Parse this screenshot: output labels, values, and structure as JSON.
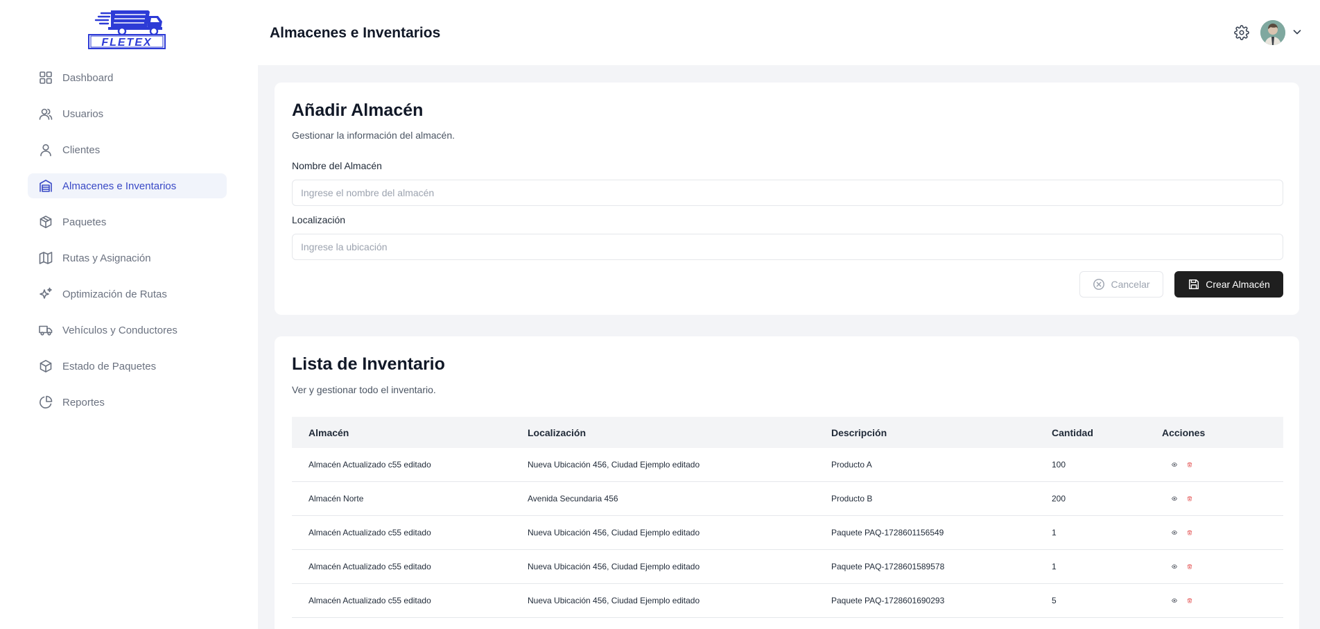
{
  "app": {
    "logo_text": "FLETEX"
  },
  "sidebar": {
    "items": [
      {
        "label": "Dashboard",
        "icon": "grid-icon"
      },
      {
        "label": "Usuarios",
        "icon": "users-icon"
      },
      {
        "label": "Clientes",
        "icon": "user-icon"
      },
      {
        "label": "Almacenes e Inventarios",
        "icon": "warehouse-icon",
        "active": true
      },
      {
        "label": "Paquetes",
        "icon": "package-icon"
      },
      {
        "label": "Rutas y Asignación",
        "icon": "map-icon"
      },
      {
        "label": "Optimización de Rutas",
        "icon": "sparkles-icon"
      },
      {
        "label": "Vehículos y Conductores",
        "icon": "truck-icon"
      },
      {
        "label": "Estado de Paquetes",
        "icon": "box-icon"
      },
      {
        "label": "Reportes",
        "icon": "pie-chart-icon"
      }
    ]
  },
  "header": {
    "title": "Almacenes e Inventarios"
  },
  "form": {
    "title": "Añadir Almacén",
    "subtitle": "Gestionar la información del almacén.",
    "name_label": "Nombre del Almacén",
    "name_placeholder": "Ingrese el nombre del almacén",
    "name_value": "",
    "location_label": "Localización",
    "location_placeholder": "Ingrese la ubicación",
    "location_value": "",
    "cancel_label": "Cancelar",
    "create_label": "Crear Almacén"
  },
  "inventory": {
    "title": "Lista de Inventario",
    "subtitle": "Ver y gestionar todo el inventario.",
    "columns": [
      "Almacén",
      "Localización",
      "Descripción",
      "Cantidad",
      "Acciones"
    ],
    "rows": [
      {
        "almacen": "Almacén Actualizado c55 editado",
        "localizacion": "Nueva Ubicación 456, Ciudad Ejemplo editado",
        "descripcion": "Producto A",
        "cantidad": "100"
      },
      {
        "almacen": "Almacén Norte",
        "localizacion": "Avenida Secundaria 456",
        "descripcion": "Producto B",
        "cantidad": "200"
      },
      {
        "almacen": "Almacén Actualizado c55 editado",
        "localizacion": "Nueva Ubicación 456, Ciudad Ejemplo editado",
        "descripcion": "Paquete PAQ-1728601156549",
        "cantidad": "1"
      },
      {
        "almacen": "Almacén Actualizado c55 editado",
        "localizacion": "Nueva Ubicación 456, Ciudad Ejemplo editado",
        "descripcion": "Paquete PAQ-1728601589578",
        "cantidad": "1"
      },
      {
        "almacen": "Almacén Actualizado c55 editado",
        "localizacion": "Nueva Ubicación 456, Ciudad Ejemplo editado",
        "descripcion": "Paquete PAQ-1728601690293",
        "cantidad": "5"
      }
    ]
  },
  "colors": {
    "accent": "#3949c6",
    "danger": "#dc2626",
    "primary_button": "#1f1f1f",
    "background": "#f3f4f7"
  }
}
